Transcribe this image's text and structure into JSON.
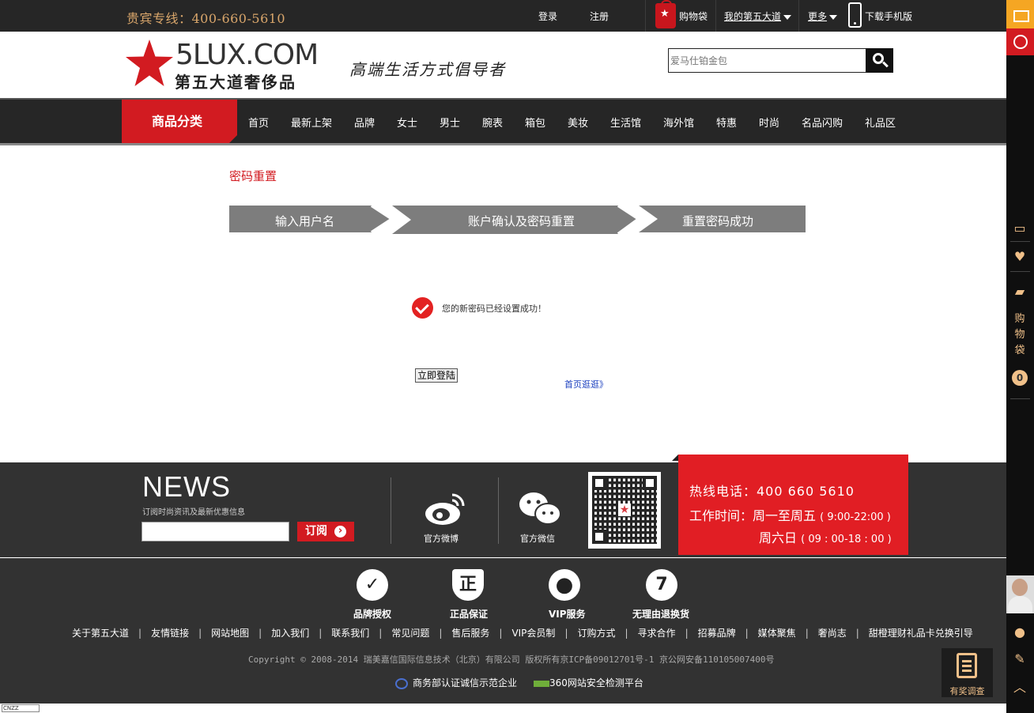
{
  "topbar": {
    "hotline": "贵宾专线：400-660-5610",
    "login": "登录",
    "register": "注册",
    "cart": "购物袋",
    "my_account": "我的第五大道",
    "more": "更多",
    "download_app": "下载手机版"
  },
  "header": {
    "logo_main": "5LUX.COM",
    "logo_sub": "第五大道奢侈品",
    "slogan": "高端生活方式倡导者",
    "search_placeholder": "爱马仕铂金包"
  },
  "nav": {
    "category": "商品分类",
    "items": [
      "首页",
      "最新上架",
      "品牌",
      "女士",
      "男士",
      "腕表",
      "箱包",
      "美妆",
      "生活馆",
      "海外馆",
      "特惠",
      "时尚",
      "名品闪购",
      "礼品区"
    ]
  },
  "main": {
    "title": "密码重置",
    "steps": [
      "输入用户名",
      "账户确认及密码重置",
      "重置密码成功"
    ],
    "success_message": "您的新密码已经设置成功！",
    "login_button": "立即登陆",
    "home_link": "首页逛逛》"
  },
  "newsletter": {
    "title": "NEWS",
    "subtitle": "订阅时尚资讯及最新优惠信息",
    "subscribe_button": "订阅"
  },
  "social": {
    "weibo": "官方微博",
    "wechat": "官方微信"
  },
  "hotline_box": {
    "phone": "热线电话：400 660 5610",
    "hours_label": "工作时间：周一至周五",
    "hours_weekday": "( 9:00-22:00 )",
    "saturday": "周六日",
    "hours_weekend": "( 09 : 00-18 : 00 )"
  },
  "badges": [
    "品牌授权",
    "正品保证",
    "VIP服务",
    "无理由退换货"
  ],
  "badge_glyphs": [
    "✓",
    "正",
    "●",
    "7"
  ],
  "footer_links": [
    "关于第五大道",
    "友情链接",
    "网站地图",
    "加入我们",
    "联系我们",
    "常见问题",
    "售后服务",
    "VIP会员制",
    "订购方式",
    "寻求合作",
    "招募品牌",
    "媒体聚焦",
    "奢尚志",
    "甜橙理财礼品卡兑换引导"
  ],
  "copyright": "Copyright © 2008-2014 瑞美嘉信国际信息技术（北京）有限公司    版权所有京ICP备09012701号-1    京公网安备110105007400号",
  "certs": {
    "commerce": "商务部认证诚信示范企业",
    "security": "360网站安全检测平台"
  },
  "sidebar": {
    "cart_text": "购物袋",
    "cart_count": "0",
    "survey": "有奖调查"
  },
  "stats_badge": "CNZZ",
  "colors": {
    "brand_red": "#d21b21",
    "dark": "#262626",
    "footer": "#323232",
    "gold": "#f0c089"
  }
}
